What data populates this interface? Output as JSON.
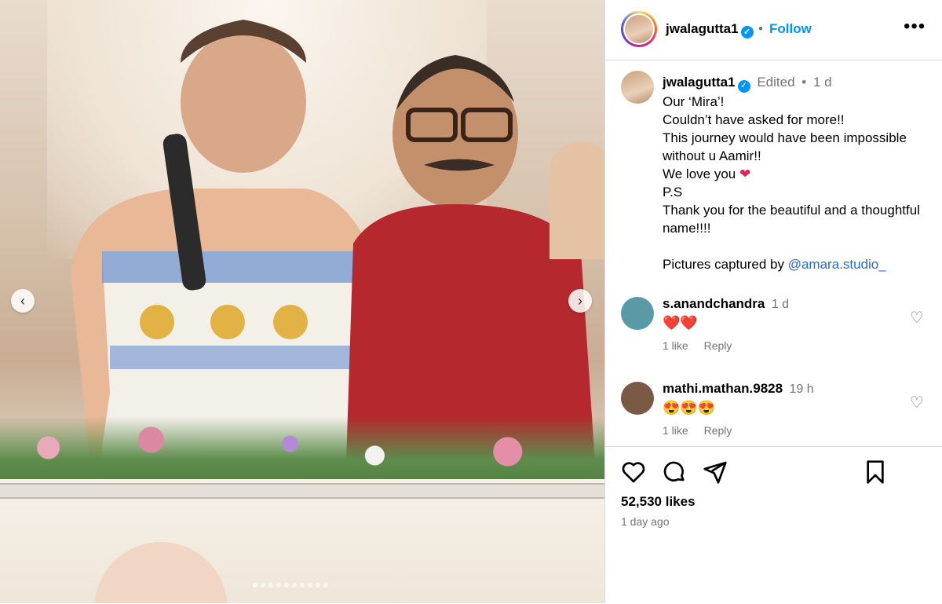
{
  "post": {
    "username": "jwalagutta1",
    "follow_label": "Follow",
    "header_dot": "•",
    "more_label": "•••"
  },
  "caption": {
    "username": "jwalagutta1",
    "edited": "Edited",
    "dot": "•",
    "time": "1 d",
    "lines": [
      "Our ‘Mira’!",
      "Couldn’t have asked for more!!",
      "This journey would have been impossible without u Aamir!!",
      "We love you",
      "P.S",
      "Thank you for the beautiful and a thoughtful name!!!!",
      "",
      "Pictures captured by"
    ],
    "heart": "❤",
    "mention": "@amara.studio_"
  },
  "comments": [
    {
      "username": "s.anandchandra",
      "time": "1 d",
      "text": "❤️❤️",
      "likes": "1 like",
      "reply": "Reply",
      "avatar_color": "#5a9aa6"
    },
    {
      "username": "mathi.mathan.9828",
      "time": "19 h",
      "text": "😍😍😍",
      "likes": "1 like",
      "reply": "Reply",
      "avatar_color": "#7a5a44"
    }
  ],
  "footer": {
    "likes_count": "52,530 likes",
    "time_ago": "1 day ago"
  },
  "carousel": {
    "prev": "‹",
    "next": "›",
    "slide_count": 10,
    "active_index": 0
  }
}
